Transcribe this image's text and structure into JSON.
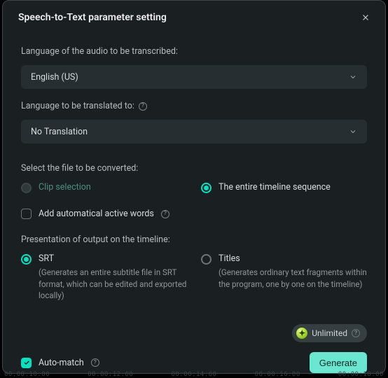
{
  "dialog": {
    "title": "Speech-to-Text parameter setting",
    "labels": {
      "audio_lang": "Language of the audio to be transcribed:",
      "translate_lang": "Language to be translated to:",
      "select_file": "Select the file to be converted:",
      "presentation": "Presentation of output on the timeline:"
    },
    "selects": {
      "audio_lang_value": "English (US)",
      "translate_lang_value": "No Translation"
    },
    "file_options": {
      "clip": "Clip selection",
      "timeline": "The entire timeline sequence"
    },
    "auto_words": "Add automatical active words",
    "output_options": {
      "srt": {
        "label": "SRT",
        "desc": "(Generates an entire subtitle file in SRT format, which can be edited and exported locally)"
      },
      "titles": {
        "label": "Titles",
        "desc": "(Generates ordinary text fragments within the program, one by one on the timeline)"
      }
    },
    "badge": "Unlimited",
    "auto_match": "Auto-match",
    "generate": "Generate"
  },
  "timeline_marks": [
    "00:00:10:00",
    "00:00:12:00",
    "00:00:14:00",
    "00:00:16:00",
    "00:00:18:00"
  ]
}
